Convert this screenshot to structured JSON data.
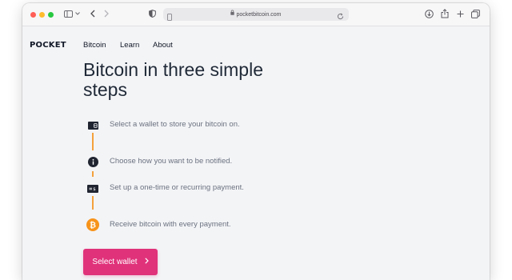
{
  "browser": {
    "url": "pocketbitcoin.com",
    "icons": [
      "close-light",
      "minimize-light",
      "zoom-light",
      "sidebar-icon",
      "chevron-down-icon",
      "back-icon",
      "forward-icon",
      "shield-icon",
      "page-icon",
      "lock-icon",
      "reload-icon",
      "download-icon",
      "share-icon",
      "new-tab-icon",
      "tab-overview-icon"
    ]
  },
  "site": {
    "logo": "POCKET",
    "nav": [
      "Bitcoin",
      "Learn",
      "About"
    ]
  },
  "hero": {
    "title": "Bitcoin in three simple steps"
  },
  "steps": [
    {
      "icon": "wallet-icon",
      "text": "Select a wallet to store your bitcoin on."
    },
    {
      "icon": "info-icon",
      "text": "Choose how you want to be notified."
    },
    {
      "icon": "payment-icon",
      "text": "Set up a one-time or recurring payment."
    },
    {
      "icon": "bitcoin-icon",
      "text": "Receive bitcoin with every payment."
    }
  ],
  "cta": {
    "label": "Select wallet",
    "color": "#e0327a"
  },
  "colors": {
    "accent": "#e0327a",
    "connector": "#f5a13c",
    "bitcoin": "#f7931a",
    "background": "#f3f4f6"
  }
}
